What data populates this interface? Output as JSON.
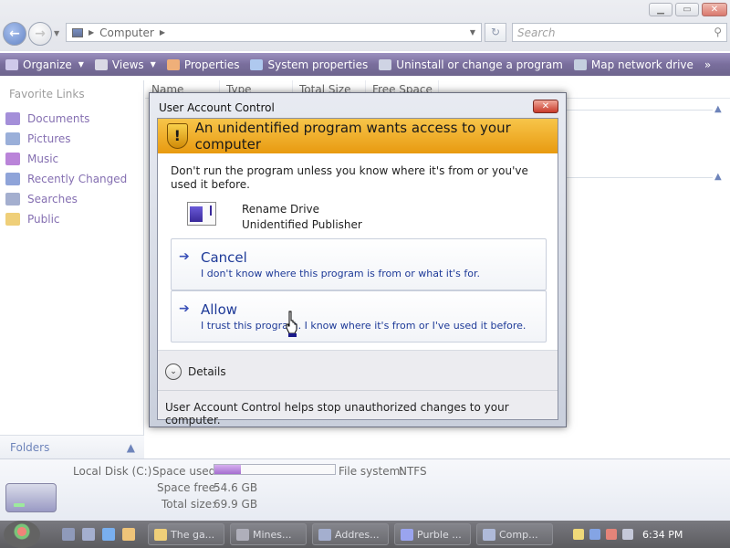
{
  "window": {
    "minimize_icon": "minimize-icon",
    "maximize_icon": "maximize-icon",
    "close_icon": "close-icon"
  },
  "address_bar": {
    "crumb": "Computer",
    "search_placeholder": "Search"
  },
  "toolbar": {
    "items": [
      {
        "label": "Organize",
        "icon": "organize-icon",
        "caret": true
      },
      {
        "label": "Views",
        "icon": "views-icon",
        "caret": true
      },
      {
        "label": "Properties",
        "icon": "properties-icon"
      },
      {
        "label": "System properties",
        "icon": "system-properties-icon"
      },
      {
        "label": "Uninstall or change a program",
        "icon": "uninstall-icon"
      },
      {
        "label": "Map network drive",
        "icon": "map-drive-icon"
      }
    ],
    "overflow": "»"
  },
  "left_pane": {
    "heading": "Favorite Links",
    "links": [
      {
        "label": "Documents",
        "color": "#7a5ac8"
      },
      {
        "label": "Pictures",
        "color": "#6a8ac8"
      },
      {
        "label": "Music",
        "color": "#9a4ac8"
      },
      {
        "label": "Recently Changed",
        "color": "#5a7ac8"
      },
      {
        "label": "Searches",
        "color": "#7a8ab8"
      },
      {
        "label": "Public",
        "color": "#e8b83a"
      }
    ],
    "folders_label": "Folders"
  },
  "columns": [
    "Name",
    "Type",
    "Total Size",
    "Free Space"
  ],
  "details_pane": {
    "drive_name": "Local Disk (C:)",
    "space_used_label": "Space used:",
    "space_used_fraction": 0.22,
    "file_system_label": "File system:",
    "file_system": "NTFS",
    "space_free_label": "Space free:",
    "space_free": "54.6 GB",
    "total_size_label": "Total size:",
    "total_size": "69.9 GB"
  },
  "taskbar": {
    "tasks": [
      "The ga...",
      "Mines...",
      "Addres...",
      "Purble ...",
      "Comp..."
    ],
    "clock": "6:34 PM"
  },
  "uac": {
    "title": "User Account Control",
    "banner": "An unidentified program wants access to your computer",
    "warning": "Don't run the program unless you know where it's from or you've used it before.",
    "program_name": "Rename Drive",
    "publisher": "Unidentified Publisher",
    "cancel": {
      "title": "Cancel",
      "description": "I don't know where this program is from or what it's for."
    },
    "allow": {
      "title": "Allow",
      "description": "I trust this program. I know where it's from or I've used it before."
    },
    "details_label": "Details",
    "footer": "User Account Control helps stop unauthorized changes to your computer."
  }
}
